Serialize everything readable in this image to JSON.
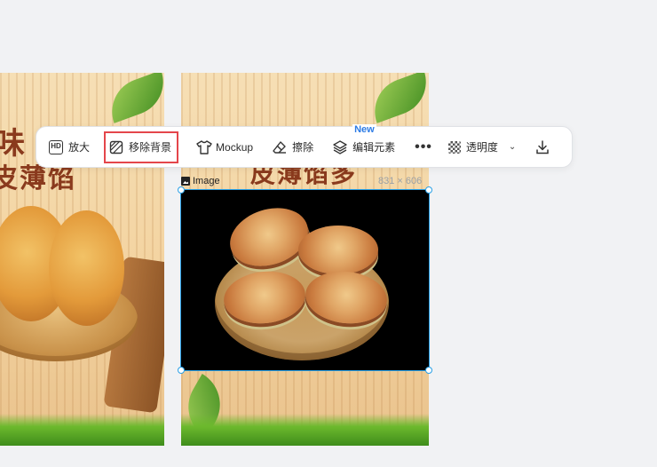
{
  "toolbar": {
    "upscale_label": "放大",
    "remove_bg_label": "移除背景",
    "mockup_label": "Mockup",
    "erase_label": "擦除",
    "edit_elements_label": "编辑元素",
    "new_badge": "New",
    "more_label": "•••",
    "opacity_label": "透明度"
  },
  "selection": {
    "type_label": "Image",
    "size_label": "831 × 606"
  },
  "poster": {
    "left_line1": "味",
    "left_line2": "皮薄馅",
    "right_line2": "皮薄馅多"
  },
  "colors": {
    "selection": "#2aa0e6",
    "active_outline": "#e4464b",
    "badge": "#2c7be5",
    "background": "#f1f2f4"
  }
}
